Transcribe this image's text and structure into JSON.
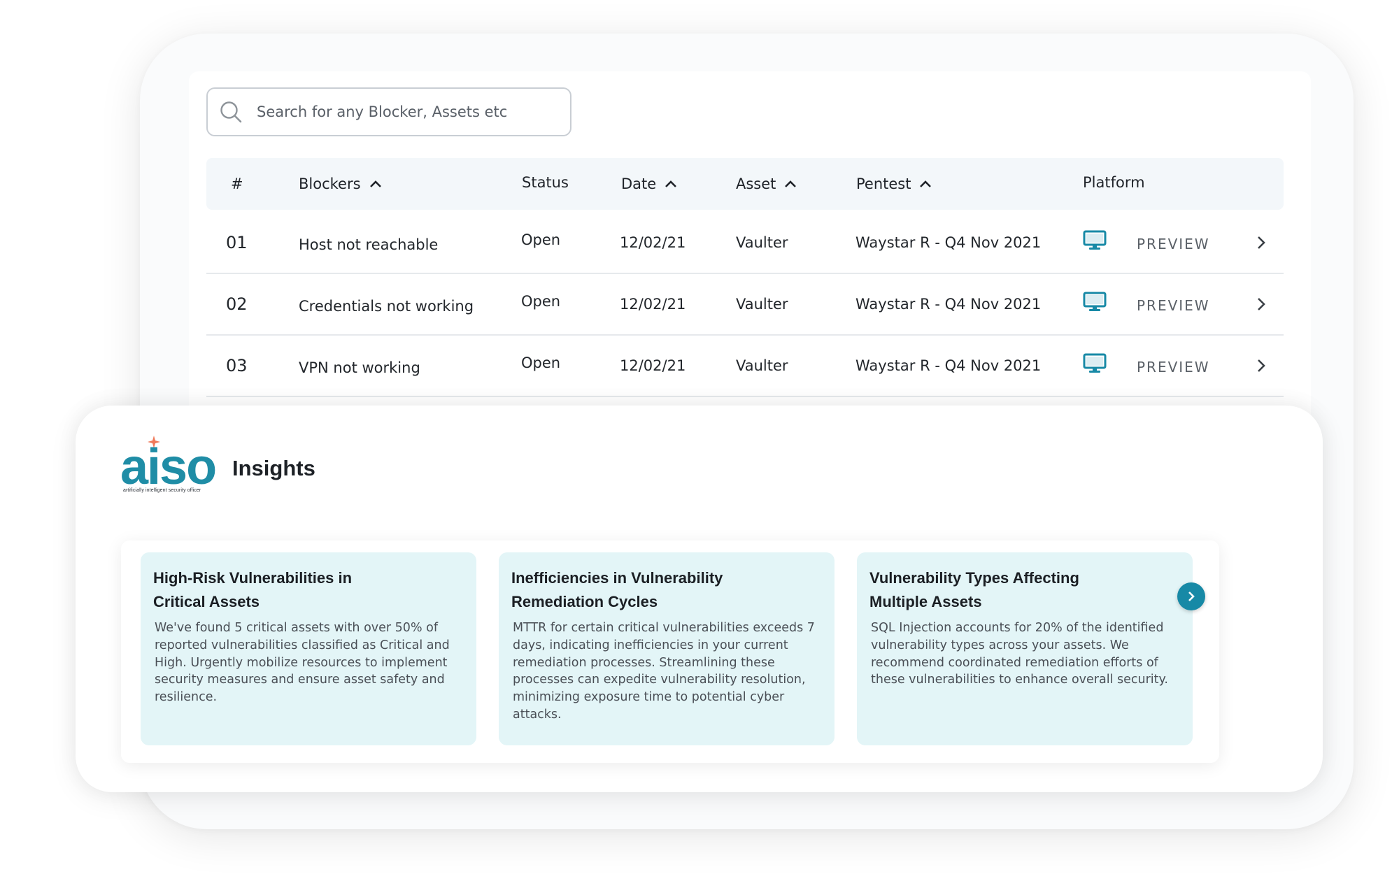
{
  "search": {
    "placeholder": "Search for any Blocker, Assets etc"
  },
  "table": {
    "columns": {
      "index": "#",
      "blockers": "Blockers",
      "status": "Status",
      "date": "Date",
      "asset": "Asset",
      "pentest": "Pentest",
      "platform": "Platform"
    },
    "sortable_columns": [
      "Blockers",
      "Date",
      "Asset",
      "Pentest"
    ],
    "rows": [
      {
        "num": "01",
        "blocker": "Host not reachable",
        "status": "Open",
        "date": "12/02/21",
        "asset": "Vaulter",
        "pentest": "Waystar R - Q4 Nov 2021",
        "platform_icon": "monitor-icon",
        "action": "PREVIEW"
      },
      {
        "num": "02",
        "blocker": "Credentials not working",
        "status": "Open",
        "date": "12/02/21",
        "asset": "Vaulter",
        "pentest": "Waystar R - Q4 Nov 2021",
        "platform_icon": "monitor-icon",
        "action": "PREVIEW"
      },
      {
        "num": "03",
        "blocker": "VPN not working",
        "status": "Open",
        "date": "12/02/21",
        "asset": "Vaulter",
        "pentest": "Waystar R - Q4 Nov 2021",
        "platform_icon": "monitor-icon",
        "action": "PREVIEW"
      }
    ]
  },
  "insights": {
    "logo": {
      "wordmark": "aiso",
      "tagline": "artificially intelligent security officer"
    },
    "title": "Insights",
    "cards": [
      {
        "title_line1": "High-Risk Vulnerabilities in",
        "title_line2": "Critical Assets",
        "body": "We've found 5 critical assets with over 50% of reported vulnerabilities classified as Critical and High. Urgently mobilize resources to implement security measures and ensure asset safety and resilience."
      },
      {
        "title_line1": "Inefficiencies in Vulnerability",
        "title_line2": "Remediation Cycles",
        "body": "MTTR for certain critical vulnerabilities exceeds 7 days, indicating inefficiencies in your current remediation processes. Streamlining these processes can expedite vulnerability resolution, minimizing exposure time to potential cyber attacks."
      },
      {
        "title_line1": "Vulnerability Types Affecting",
        "title_line2": "Multiple Assets",
        "body": "SQL Injection accounts for 20% of the identified vulnerability types across your assets. We recommend coordinated remediation efforts of these vulnerabilities to enhance overall security."
      }
    ]
  },
  "colors": {
    "accent": "#1f8da6",
    "next_button": "#1789a6",
    "card_bg": "#e3f5f7",
    "header_bg": "#f3f7fa",
    "sparkle": "#f07a5a"
  }
}
